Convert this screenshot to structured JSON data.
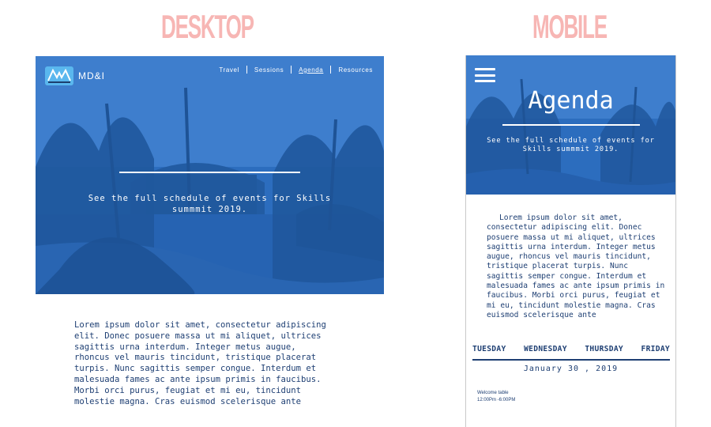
{
  "labels": {
    "desktop": "DESKTOP",
    "mobile": "MOBILE"
  },
  "colors": {
    "hero_blue": "#2b68b4",
    "heading_pink": "#f7b6b4",
    "body_navy": "#1e3f73"
  },
  "desktop": {
    "brand": "MD&I",
    "nav": [
      {
        "label": "Travel",
        "active": false
      },
      {
        "label": "Sessions",
        "active": false
      },
      {
        "label": "Agenda",
        "active": true
      },
      {
        "label": "Resources",
        "active": false
      }
    ],
    "tagline": "See the full schedule of events for Skills summmit 2019.",
    "body": "Lorem ipsum dolor sit amet, consectetur adipiscing elit. Donec posuere massa ut mi aliquet, ultrices sagittis urna interdum. Integer metus augue, rhoncus vel mauris tincidunt, tristique placerat turpis. Nunc sagittis semper congue. Interdum et malesuada fames ac ante ipsum primis in faucibus. Morbi orci purus, feugiat et mi eu, tincidunt molestie magna. Cras euismod scelerisque ante"
  },
  "mobile": {
    "title": "Agenda",
    "tagline": "See the full schedule of events for Skills summmit 2019.",
    "body": "Lorem ipsum dolor sit amet, consectetur adipiscing elit. Donec posuere massa ut mi aliquet, ultrices sagittis urna interdum. Integer metus augue, rhoncus vel mauris tincidunt, tristique placerat turpis. Nunc sagittis semper congue. Interdum et malesuada fames ac ante ipsum primis in faucibus. Morbi orci purus, feugiat et mi eu, tincidunt molestie magna. Cras euismod scelerisque ante",
    "days": [
      "TUESDAY",
      "WEDNESDAY",
      "THURSDAY",
      "FRIDAY"
    ],
    "date": "January 30 , 2019",
    "event": {
      "name": "Welcome table",
      "time": "12:00Pm -6:00PM"
    }
  }
}
